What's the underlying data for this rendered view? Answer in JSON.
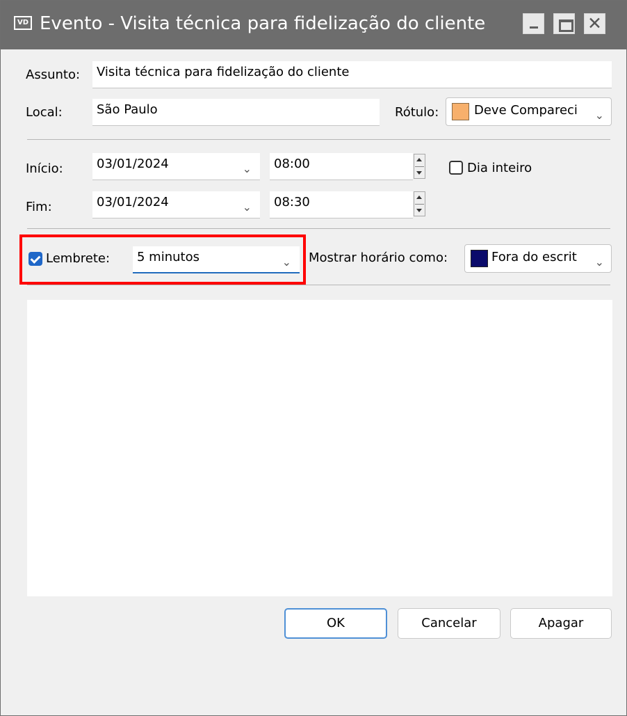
{
  "window": {
    "app_icon": "VD",
    "title": "Evento - Visita técnica para fidelização do cliente",
    "controls": {
      "minimize_icon": "minimize-icon",
      "maximize_icon": "maximize-icon",
      "close": "✕"
    }
  },
  "form": {
    "assunto": {
      "label": "Assunto:",
      "value": "Visita técnica para fidelização do cliente"
    },
    "local": {
      "label": "Local:",
      "value": "São Paulo"
    },
    "rotulo": {
      "label": "Rótulo:",
      "value": "Deve Compareci",
      "color": "#f7b06c"
    },
    "inicio": {
      "label": "Início:",
      "date": "03/01/2024",
      "time": "08:00"
    },
    "fim": {
      "label": "Fim:",
      "date": "03/01/2024",
      "time": "08:30"
    },
    "dia_inteiro": {
      "label": "Dia inteiro",
      "checked": false
    },
    "lembrete": {
      "label": "Lembrete:",
      "checked": true,
      "value": "5 minutos"
    },
    "mostrar_horario": {
      "label": "Mostrar horário como:",
      "value": "Fora do escrit",
      "color": "#0b0b6b"
    }
  },
  "buttons": {
    "ok": "OK",
    "cancel": "Cancelar",
    "delete": "Apagar"
  }
}
